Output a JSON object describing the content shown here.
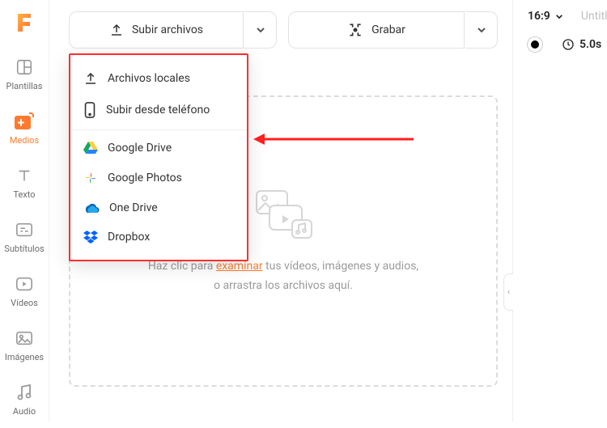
{
  "sidebar": {
    "items": [
      {
        "label": "Plantillas"
      },
      {
        "label": "Medios"
      },
      {
        "label": "Texto"
      },
      {
        "label": "Subtítulos"
      },
      {
        "label": "Vídeos"
      },
      {
        "label": "Imágenes"
      },
      {
        "label": "Audio"
      }
    ]
  },
  "toolbar": {
    "upload_label": "Subir archivos",
    "record_label": "Grabar"
  },
  "dropdown": {
    "local": "Archivos locales",
    "phone": "Subir desde teléfono",
    "gdrive": "Google Drive",
    "gphotos": "Google Photos",
    "onedrive": "One Drive",
    "dropbox": "Dropbox"
  },
  "dropzone": {
    "pre": "Haz clic para ",
    "link": "examinar",
    "post": " tus vídeos, imágenes y audios,",
    "line2": "o arrastra los archivos aquí."
  },
  "right": {
    "ratio": "16:9",
    "untitled": "Untitled",
    "duration": "5.0s"
  }
}
